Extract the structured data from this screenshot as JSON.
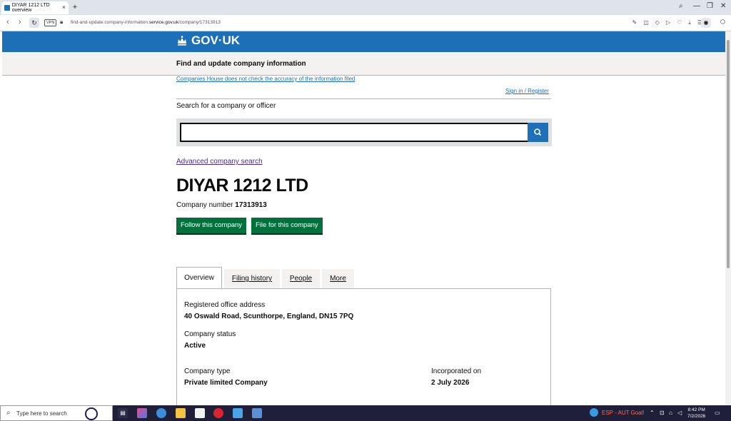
{
  "browser": {
    "tab_title": "DIYAR 1212 LTD overview",
    "url_prefix": "find-and-update.company-information.",
    "url_domain": "service.gov.uk",
    "url_path": "/company/17313913",
    "vpn_label": "VPN"
  },
  "header": {
    "logo_text": "GOV·UK",
    "service_name": "Find and update company information"
  },
  "notice_link": "Companies House does not check the accuracy of the information filed",
  "signin_link": "Sign in / Register",
  "search": {
    "label": "Search for a company or officer",
    "value": "",
    "placeholder": ""
  },
  "advanced_search_link": "Advanced company search",
  "company": {
    "name": "DIYAR 1212 LTD",
    "number_label": "Company number",
    "number": "17313913"
  },
  "buttons": {
    "follow": "Follow this company",
    "file": "File for this company"
  },
  "tabs": [
    {
      "label": "Overview",
      "active": true
    },
    {
      "label": "Filing history",
      "active": false
    },
    {
      "label": "People",
      "active": false
    },
    {
      "label": "More",
      "active": false
    }
  ],
  "overview": {
    "address_label": "Registered office address",
    "address_value": "40 Oswald Road, Scunthorpe, England, DN15 7PQ",
    "status_label": "Company status",
    "status_value": "Active",
    "type_label": "Company type",
    "type_value": "Private limited Company",
    "incorporated_label": "Incorporated on",
    "incorporated_value": "2 July 2026"
  },
  "taskbar": {
    "search_placeholder": "Type here to search",
    "news_text": "ESP - AUT Goal!",
    "time": "8:42 PM",
    "date": "7/2/2026"
  },
  "colors": {
    "gov_blue": "#1d70b8",
    "button_green": "#00703c",
    "link_purple": "#4c2c92"
  }
}
